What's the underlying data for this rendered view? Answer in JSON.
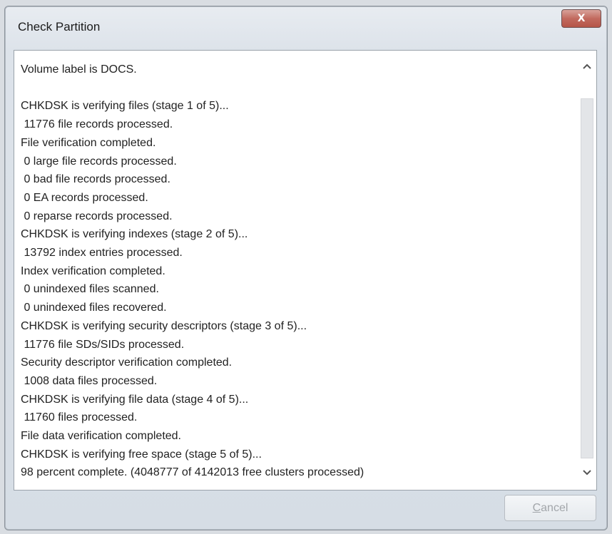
{
  "window": {
    "title": "Check Partition",
    "close_label": "X"
  },
  "log": {
    "lines": [
      "Volume label is DOCS.",
      "",
      "CHKDSK is verifying files (stage 1 of 5)...",
      " 11776 file records processed.",
      "File verification completed.",
      " 0 large file records processed.",
      " 0 bad file records processed.",
      " 0 EA records processed.",
      " 0 reparse records processed.",
      "CHKDSK is verifying indexes (stage 2 of 5)...",
      " 13792 index entries processed.",
      "Index verification completed.",
      " 0 unindexed files scanned.",
      " 0 unindexed files recovered.",
      "CHKDSK is verifying security descriptors (stage 3 of 5)...",
      " 11776 file SDs/SIDs processed.",
      "Security descriptor verification completed.",
      " 1008 data files processed.",
      "CHKDSK is verifying file data (stage 4 of 5)...",
      " 11760 files processed.",
      "File data verification completed.",
      "CHKDSK is verifying free space (stage 5 of 5)...",
      "98 percent complete. (4048777 of 4142013 free clusters processed)"
    ]
  },
  "buttons": {
    "cancel_first": "C",
    "cancel_rest": "ancel"
  },
  "icons": {
    "scroll_up": "chevron-up-icon",
    "scroll_down": "chevron-down-icon",
    "close": "close-icon"
  }
}
